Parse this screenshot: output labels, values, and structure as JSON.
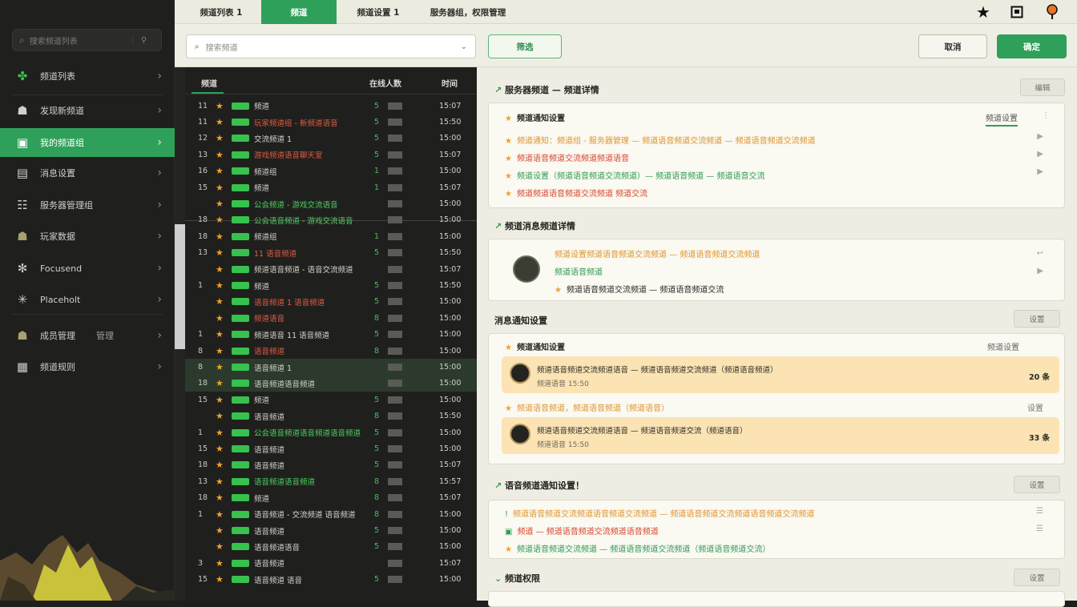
{
  "sidebar": {
    "search": {
      "placeholder": "搜索频道列表"
    },
    "items": [
      {
        "label": "频道列表",
        "icon": "grid-icon"
      },
      {
        "label": "发现新频道",
        "icon": "person-icon"
      },
      {
        "label": "我的频道组",
        "icon": "chat-icon"
      },
      {
        "label": "消息设置",
        "icon": "message-icon"
      },
      {
        "label": "服务器管理组",
        "icon": "server-icon"
      },
      {
        "label": "玩家数据",
        "icon": "player-icon"
      },
      {
        "label": "Focusend",
        "icon": "gear-icon"
      },
      {
        "label": "Placeholt",
        "icon": "sparkle-icon"
      },
      {
        "label": "成员管理",
        "extra": "管理",
        "icon": "members-icon"
      },
      {
        "label": "频道规则",
        "icon": "rules-icon"
      }
    ]
  },
  "topbar": {
    "tabs": [
      "频道列表 1",
      "频道",
      "频道设置 1",
      "服务器组，权限管理"
    ]
  },
  "toolbar": {
    "filter_placeholder": "搜索频道",
    "filter_button": "筛选",
    "secondary_button": "取消",
    "primary_button": "确定"
  },
  "table": {
    "headers": {
      "name": "频道",
      "count": "在线人数",
      "time": "时间"
    },
    "rows": [
      {
        "num": "11",
        "name": "频道",
        "color": "",
        "count": "5",
        "time": "15:07"
      },
      {
        "num": "11",
        "name": "玩家频道组 - 新频道语音",
        "color": "red",
        "count": "5",
        "time": "15:50"
      },
      {
        "num": "12",
        "name": "交流频道 1",
        "color": "",
        "count": "5",
        "time": "15:00"
      },
      {
        "num": "13",
        "name": "游戏频道语音聊天室",
        "color": "red",
        "count": "5",
        "time": "15:07"
      },
      {
        "num": "16",
        "name": "频道组",
        "color": "",
        "count": "1",
        "time": "15:00"
      },
      {
        "num": "15",
        "name": "频道",
        "color": "",
        "count": "1",
        "time": "15:07"
      },
      {
        "num": "",
        "name": "公会频道 - 游戏交流语音",
        "color": "green",
        "count": "",
        "time": "15:00"
      },
      {
        "num": "18",
        "name": "公会语音频道 - 游戏交流语音",
        "color": "green",
        "count": "",
        "time": "15:00"
      },
      {
        "num": "18",
        "name": "频道组",
        "color": "",
        "count": "1",
        "time": "15:00"
      },
      {
        "num": "13",
        "name": "11 语音频道",
        "color": "red",
        "count": "5",
        "time": "15:50"
      },
      {
        "num": "",
        "name": "频道语音频道 - 语音交流频道",
        "color": "",
        "count": "",
        "time": "15:07"
      },
      {
        "num": "1",
        "name": "频道",
        "color": "",
        "count": "5",
        "time": "15:50"
      },
      {
        "num": "",
        "name": "语音频道 1 语音频道",
        "color": "red",
        "count": "5",
        "time": "15:00"
      },
      {
        "num": "",
        "name": "频道语音",
        "color": "red",
        "count": "8",
        "time": "15:00"
      },
      {
        "num": "1",
        "name": "频道语音 11 语音频道",
        "color": "",
        "count": "5",
        "time": "15:00"
      },
      {
        "num": "8",
        "name": "语音频道",
        "color": "red",
        "count": "8",
        "time": "15:00"
      },
      {
        "num": "8",
        "name": "语音频道 1",
        "color": "",
        "count": "",
        "time": "15:00",
        "hl": true
      },
      {
        "num": "18",
        "name": "语音频道语音频道",
        "color": "",
        "count": "",
        "time": "15:00",
        "hl": true
      },
      {
        "num": "15",
        "name": "频道",
        "color": "",
        "count": "5",
        "time": "15:00"
      },
      {
        "num": "",
        "name": "语音频道",
        "color": "",
        "count": "8",
        "time": "15:50"
      },
      {
        "num": "1",
        "name": "公会语音频道语音频道语音频道",
        "color": "green",
        "count": "5",
        "time": "15:00"
      },
      {
        "num": "15",
        "name": "语音频道",
        "color": "",
        "count": "5",
        "time": "15:00"
      },
      {
        "num": "18",
        "name": "语音频道",
        "color": "",
        "count": "5",
        "time": "15:07"
      },
      {
        "num": "13",
        "name": "语音频道语音频道",
        "color": "green",
        "count": "8",
        "time": "15:57"
      },
      {
        "num": "18",
        "name": "频道",
        "color": "",
        "count": "8",
        "time": "15:07"
      },
      {
        "num": "1",
        "name": "语音频道 - 交流频道 语音频道",
        "color": "",
        "count": "8",
        "time": "15:00"
      },
      {
        "num": "",
        "name": "语音频道",
        "color": "",
        "count": "5",
        "time": "15:00"
      },
      {
        "num": "",
        "name": "语音频道语音",
        "color": "",
        "count": "5",
        "time": "15:00"
      },
      {
        "num": "3",
        "name": "语音频道",
        "color": "",
        "count": "",
        "time": "15:07"
      },
      {
        "num": "15",
        "name": "语音频道 语音",
        "color": "",
        "count": "5",
        "time": "15:00"
      }
    ]
  },
  "detail": {
    "sections": [
      {
        "title": "服务器频道 — 频道详情",
        "button": "编辑"
      },
      {
        "title": "频道消息频道详情",
        "button": ""
      },
      {
        "title": "消息通知设置",
        "button": "设置"
      },
      {
        "title": "语音频道通知设置！",
        "button": "设置"
      },
      {
        "title": "频道权限",
        "button": "设置"
      }
    ],
    "card1": {
      "header": "频道通知设置",
      "header_right": "频道设置",
      "lines": [
        "频道通知：频道组 - 服务器管理 — 频道语音频道交流频道 — 频道语音频道交流频道",
        "频道语音频道交流频道频道语音",
        "频道设置（频道语音频道交流频道）— 频道语音频道 — 频道语音交流",
        "频道频道语音频道交流频道  频道交流"
      ]
    },
    "card2": {
      "lines": [
        "频道设置频道语音频道交流频道 — 频道语音频道交流频道",
        "频道语音频道",
        "频道语音频道交流频道 — 频道语音频道交流"
      ]
    },
    "card3": {
      "header": "频道通知设置",
      "header_right": "频道设置",
      "notes": [
        {
          "text": "频道语音频道交流频道语音 — 频道语音频道交流频道（频道语音频道）",
          "sub": "频道语音  15:50",
          "amount": "20 条"
        },
        {
          "text": "频道语音频道交流频道语音 — 频道语音频道交流（频道语音）",
          "sub": "频道语音  15:50",
          "amount": "33 条"
        }
      ],
      "mid": "频道语音频道，频道语音频道（频道语音）",
      "mid_right": "设置"
    },
    "card4": {
      "lines": [
        "频道语音频道交流频道语音频道交流频道 — 频道语音频道交流频道语音频道交流频道",
        "频道 — 频道语音频道交流频道语音频道",
        "频道语音频道交流频道 — 频道语音频道交流频道（频道语音频道交流）"
      ]
    }
  },
  "colors": {
    "accent": "#2fa05a",
    "star": "#f0a030",
    "alert": "#d9472e"
  }
}
